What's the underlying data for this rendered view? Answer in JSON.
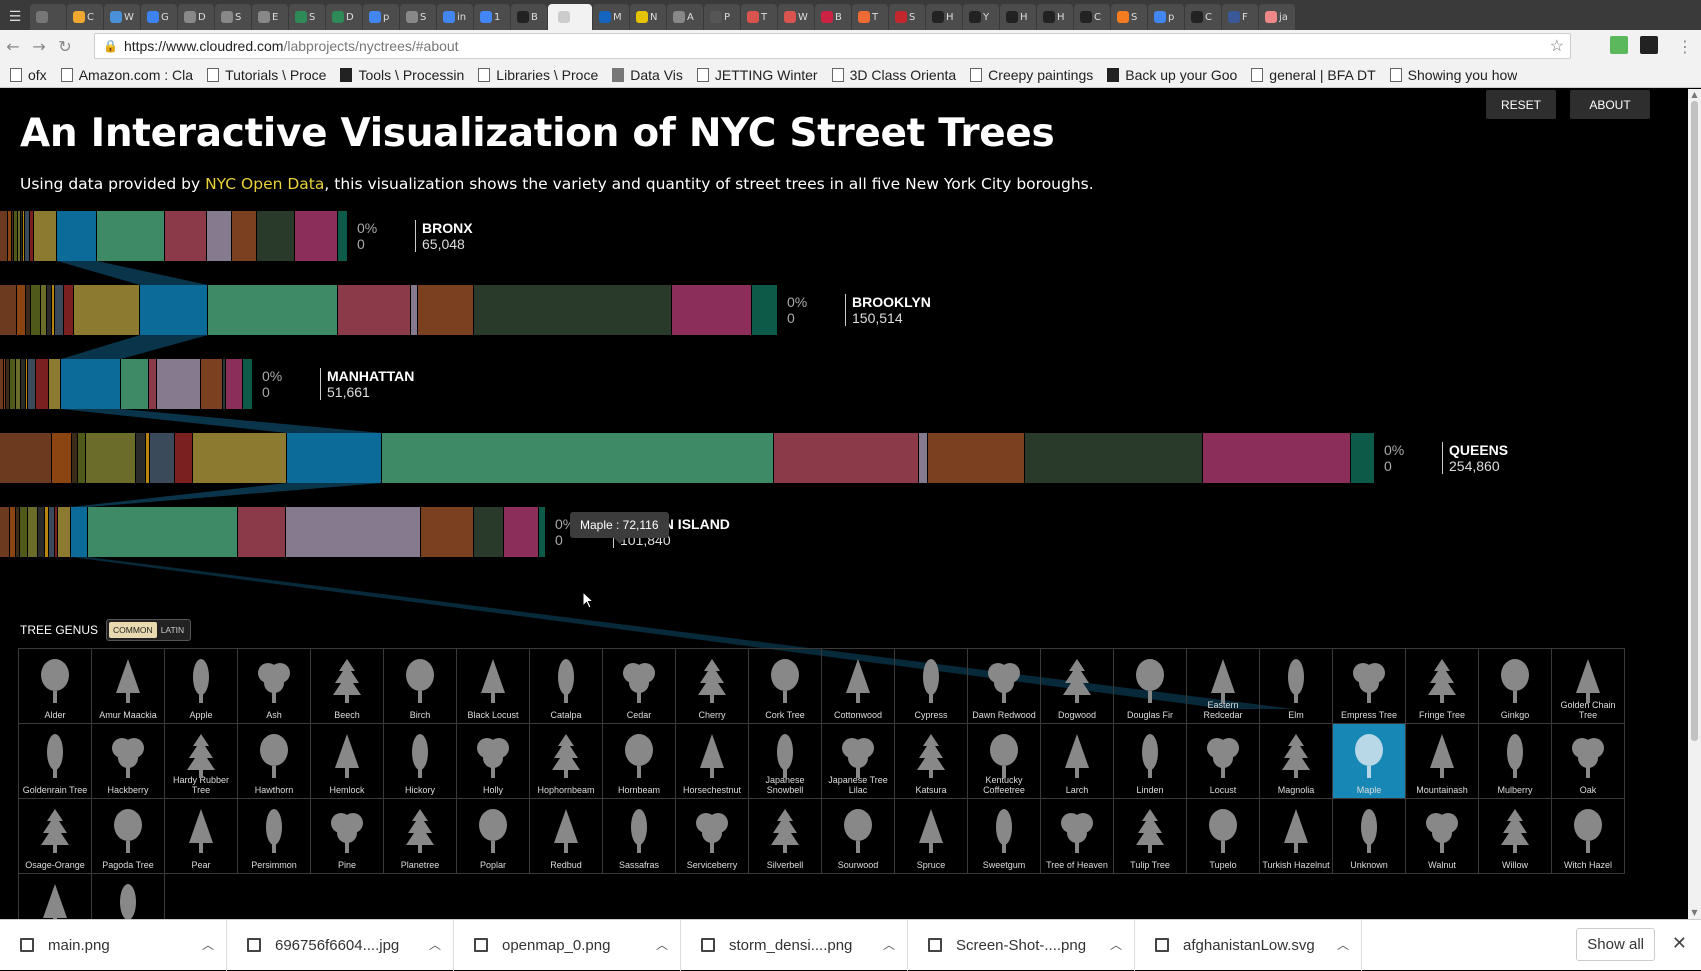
{
  "browser": {
    "tabs": [
      {
        "t": "",
        "c": "#777"
      },
      {
        "t": "C",
        "c": "#f0a830"
      },
      {
        "t": "W",
        "c": "#4a90d9"
      },
      {
        "t": "G",
        "c": "#3c82f0"
      },
      {
        "t": "D",
        "c": "#888"
      },
      {
        "t": "S",
        "c": "#888"
      },
      {
        "t": "E",
        "c": "#888"
      },
      {
        "t": "S",
        "c": "#2e8b57"
      },
      {
        "t": "D",
        "c": "#2e8b57"
      },
      {
        "t": "p",
        "c": "#4285f4"
      },
      {
        "t": "S",
        "c": "#888"
      },
      {
        "t": "in",
        "c": "#4285f4"
      },
      {
        "t": "1",
        "c": "#4285f4"
      },
      {
        "t": "B",
        "c": "#222"
      },
      {
        "t": "",
        "c": "#ccc"
      },
      {
        "t": "M",
        "c": "#1565c0"
      },
      {
        "t": "N",
        "c": "#e6c300"
      },
      {
        "t": "A",
        "c": "#888"
      },
      {
        "t": "P",
        "c": "#555"
      },
      {
        "t": "T",
        "c": "#d9534f"
      },
      {
        "t": "W",
        "c": "#d9534f"
      },
      {
        "t": "B",
        "c": "#c24"
      },
      {
        "t": "T",
        "c": "#f06a35"
      },
      {
        "t": "S",
        "c": "#c1272d"
      },
      {
        "t": "H",
        "c": "#222"
      },
      {
        "t": "Y",
        "c": "#222"
      },
      {
        "t": "H",
        "c": "#222"
      },
      {
        "t": "H",
        "c": "#222"
      },
      {
        "t": "C",
        "c": "#222"
      },
      {
        "t": "S",
        "c": "#f47b20"
      },
      {
        "t": "p",
        "c": "#4285f4"
      },
      {
        "t": "C",
        "c": "#222"
      },
      {
        "t": "F",
        "c": "#3b5998"
      },
      {
        "t": "ja",
        "c": "#e88"
      }
    ],
    "url_host": "https://www.cloudred.com",
    "url_path": "/labprojects/nyctrees/#about",
    "bookmarks": [
      "ofx",
      "Amazon.com : Cla",
      "Tutorials \\ Proce",
      "Tools \\ Processin",
      "Libraries \\ Proce",
      "Data Vis",
      "JETTING Winter",
      "3D Class Orienta",
      "Creepy paintings",
      "Back up your Goo",
      "general | BFA DT",
      "Showing you how"
    ]
  },
  "header": {
    "reset_label": "RESET",
    "about_label": "ABOUT",
    "title": "An Interactive Visualization of NYC Street Trees",
    "subtitle_pre": "Using data provided by ",
    "subtitle_link": "NYC Open Data",
    "subtitle_post": ", this visualization shows the variety and quantity of street trees in all five New York City boroughs."
  },
  "chart_data": {
    "type": "bar",
    "title": "An Interactive Visualization of NYC Street Trees",
    "categories": [
      "BRONX",
      "BROOKLYN",
      "MANHATTAN",
      "QUEENS",
      "STATEN ISLAND"
    ],
    "values": [
      65048,
      150514,
      51661,
      254860,
      101840
    ],
    "percent_labels": [
      "0%",
      "0%",
      "0%",
      "0%",
      "0%"
    ],
    "selected_labels": [
      "0",
      "0",
      "0",
      "0",
      "0"
    ],
    "highlighted_series": "Maple",
    "highlighted_values": [
      null,
      null,
      null,
      72116,
      null
    ],
    "tooltip": "Maple : 72,116",
    "segment_colors": [
      "#6b3a1f",
      "#8b4513",
      "#3d2b1a",
      "#4f5a1a",
      "#6b6b2a",
      "#2a2a2a",
      "#b8860b",
      "#3a4a5a",
      "#7a2020",
      "#8b7a30",
      "#0d6b9a",
      "#3e8a66",
      "#8b3a4a",
      "#857a8e",
      "#7a4020",
      "#2a3a2a",
      "#8b2f5a",
      "#0e5a48"
    ],
    "segments": [
      [
        8,
        4,
        2,
        4,
        3,
        2,
        2,
        5,
        4,
        23,
        40,
        68,
        42,
        25,
        25,
        38,
        43,
        10
      ],
      [
        17,
        9,
        5,
        10,
        6,
        5,
        3,
        9,
        10,
        66,
        68,
        130,
        73,
        7,
        56,
        198,
        80,
        26
      ],
      [
        4,
        2,
        4,
        6,
        5,
        5,
        2,
        8,
        13,
        12,
        60,
        28,
        8,
        44,
        22,
        3,
        17,
        10
      ],
      [
        52,
        20,
        6,
        8,
        50,
        10,
        4,
        25,
        18,
        94,
        95,
        392,
        145,
        9,
        97,
        178,
        148,
        24
      ],
      [
        10,
        6,
        4,
        8,
        10,
        7,
        4,
        6,
        3,
        13,
        17,
        150,
        48,
        135,
        53,
        30,
        35,
        7
      ]
    ]
  },
  "genus": {
    "title": "TREE GENUS",
    "toggle_common": "COMMON",
    "toggle_latin": "LATIN",
    "selected": "Maple",
    "trees": [
      "Alder",
      "Amur Maackia",
      "Apple",
      "Ash",
      "Beech",
      "Birch",
      "Black Locust",
      "Catalpa",
      "Cedar",
      "Cherry",
      "Cork Tree",
      "Cottonwood",
      "Cypress",
      "Dawn Redwood",
      "Dogwood",
      "Douglas Fir",
      "Eastern Redcedar",
      "Elm",
      "Empress Tree",
      "Fringe Tree",
      "Ginkgo",
      "Golden Chain Tree",
      "Goldenrain Tree",
      "Hackberry",
      "Hardy Rubber Tree",
      "Hawthorn",
      "Hemlock",
      "Hickory",
      "Holly",
      "Hophornbeam",
      "Hornbeam",
      "Horsechestnut",
      "Japanese Snowbell",
      "Japanese Tree Lilac",
      "Katsura",
      "Kentucky Coffeetree",
      "Larch",
      "Linden",
      "Locust",
      "Magnolia",
      "Maple",
      "Mountainash",
      "Mulberry",
      "Oak",
      "Osage-Orange",
      "Pagoda Tree",
      "Pear",
      "Persimmon",
      "Pine",
      "Planetree",
      "Poplar",
      "Redbud",
      "Sassafras",
      "Serviceberry",
      "Silverbell",
      "Sourwood",
      "Spruce",
      "Sweetgum",
      "Tree of Heaven",
      "Tulip Tree",
      "Tupelo",
      "Turkish Hazelnut",
      "Unknown",
      "Walnut",
      "Willow",
      "Witch Hazel",
      "",
      ""
    ]
  },
  "downloads": {
    "files": [
      "main.png",
      "696756f6604....jpg",
      "openmap_0.png",
      "storm_densi....png",
      "Screen-Shot-....png",
      "afghanistanLow.svg"
    ],
    "show_all": "Show all"
  }
}
